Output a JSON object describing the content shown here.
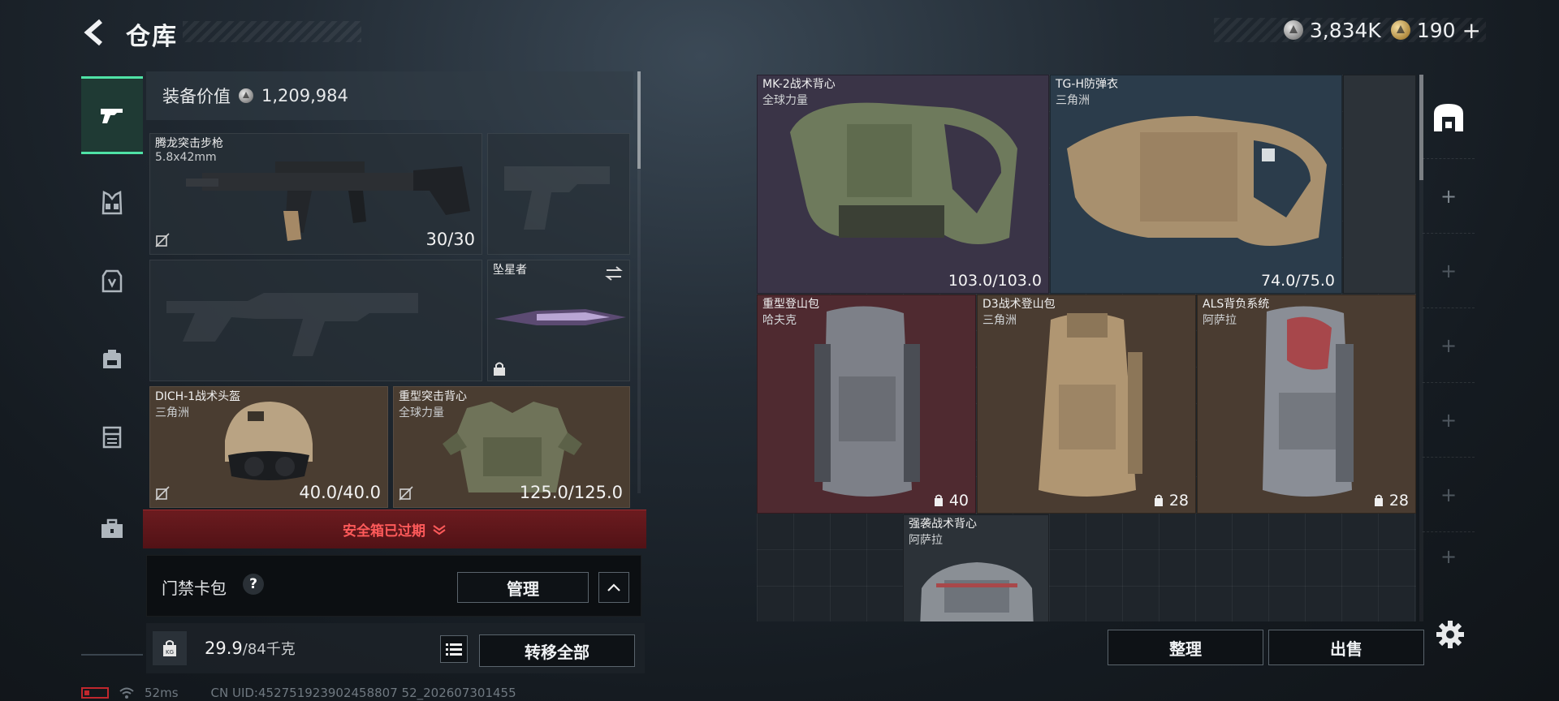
{
  "header": {
    "title": "仓库",
    "currency_silver": "3,834K",
    "currency_gold": "190",
    "currency_gold_plus": "+"
  },
  "rail": {
    "items": [
      {
        "icon": "pistol-icon",
        "active": true
      },
      {
        "icon": "chest-rig-icon",
        "active": false
      },
      {
        "icon": "backpack-icon",
        "active": false
      },
      {
        "icon": "pouch-icon",
        "active": false
      },
      {
        "icon": "container-icon",
        "active": false
      },
      {
        "icon": "toolbox-icon",
        "active": false
      }
    ]
  },
  "left": {
    "value_label": "装备价值",
    "value_amount": "1,209,984",
    "primary_weapon": {
      "name": "腾龙突击步枪",
      "caliber": "5.8x42mm",
      "ammo": "30/30"
    },
    "melee": {
      "name": "坠星者"
    },
    "helmet": {
      "name": "DICH-1战术头盔",
      "faction": "三角洲",
      "durability": "40.0/40.0"
    },
    "armor": {
      "name": "重型突击背心",
      "faction": "全球力量",
      "durability": "125.0/125.0"
    },
    "safebox_expired": "安全箱已过期",
    "keycard_label": "门禁卡包",
    "help": "?",
    "manage_button": "管理",
    "weight_current": "29.9",
    "weight_max": "/84千克",
    "transfer_all": "转移全部"
  },
  "right": {
    "items": [
      {
        "name": "MK-2战术背心",
        "faction": "全球力量",
        "durability": "103.0/103.0"
      },
      {
        "name": "TG-H防弹衣",
        "faction": "三角洲",
        "durability": "74.0/75.0"
      },
      {
        "name": "重型登山包",
        "faction": "哈夫克",
        "capacity": "40"
      },
      {
        "name": "D3战术登山包",
        "faction": "三角洲",
        "capacity": "28"
      },
      {
        "name": "ALS背负系统",
        "faction": "阿萨拉",
        "capacity": "28"
      },
      {
        "name": "强袭战术背心",
        "faction": "阿萨拉"
      }
    ],
    "sort_button": "整理",
    "sell_button": "出售",
    "side_tab_plus": "+"
  },
  "status": {
    "ping": "52ms",
    "uid": "CN UID:452751923902458807 52_202607301455"
  },
  "colors": {
    "accent_green": "#4fe2a6",
    "expired_red": "#ff5a5a"
  }
}
